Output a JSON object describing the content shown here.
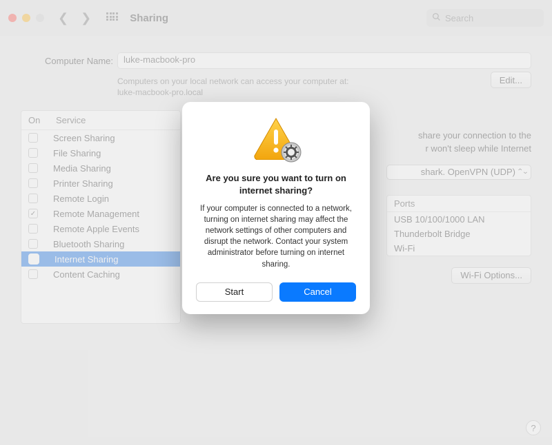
{
  "window": {
    "title": "Sharing",
    "search_placeholder": "Search"
  },
  "computer_name": {
    "label": "Computer Name:",
    "value": "luke-macbook-pro",
    "hint_line1": "Computers on your local network can access your computer at:",
    "hint_line2": "luke-macbook-pro.local",
    "edit_label": "Edit..."
  },
  "services": {
    "col_on": "On",
    "col_service": "Service",
    "items": [
      {
        "name": "Screen Sharing",
        "on": false
      },
      {
        "name": "File Sharing",
        "on": false
      },
      {
        "name": "Media Sharing",
        "on": false
      },
      {
        "name": "Printer Sharing",
        "on": false
      },
      {
        "name": "Remote Login",
        "on": false
      },
      {
        "name": "Remote Management",
        "on": true
      },
      {
        "name": "Remote Apple Events",
        "on": false
      },
      {
        "name": "Bluetooth Sharing",
        "on": false
      },
      {
        "name": "Internet Sharing",
        "on": false,
        "selected": true
      },
      {
        "name": "Content Caching",
        "on": false
      }
    ]
  },
  "info": {
    "desc_line1": "share your connection to the",
    "desc_line2": "r won't sleep while Internet",
    "share_from_value": "shark. OpenVPN (UDP)",
    "ports_header": "Ports",
    "ports": [
      "USB 10/100/1000 LAN",
      "Thunderbolt Bridge",
      "Wi-Fi"
    ],
    "wifi_options_label": "Wi-Fi Options..."
  },
  "dialog": {
    "heading": "Are you sure you want to turn on internet sharing?",
    "body": "If your computer is connected to a network, turning on internet sharing may affect the network settings of other computers and disrupt the network. Contact your system administrator before turning on internet sharing.",
    "start_label": "Start",
    "cancel_label": "Cancel"
  },
  "help_label": "?"
}
